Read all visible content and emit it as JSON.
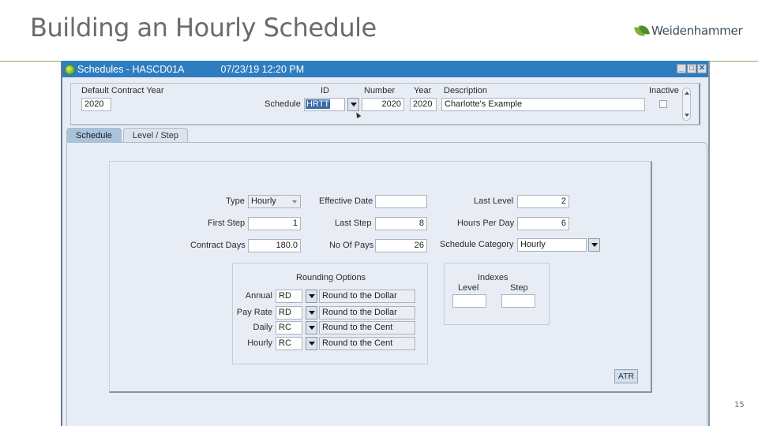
{
  "slide": {
    "title": "Building an Hourly Schedule",
    "logo_text": "Weidenhammer",
    "page_number": "15"
  },
  "window": {
    "title": "Schedules - HASCD01A",
    "timestamp": "07/23/19  12:20 PM",
    "controls": {
      "minimize": "_",
      "maximize": "□",
      "close": "✕"
    }
  },
  "header": {
    "default_contract_year_label": "Default Contract Year",
    "default_contract_year_value": "2020",
    "schedule_label": "Schedule",
    "id_label": "ID",
    "id_value": "HRTT",
    "number_label": "Number",
    "number_value": "2020",
    "year_label": "Year",
    "year_value": "2020",
    "description_label": "Description",
    "description_value": "Charlotte's Example",
    "inactive_label": "Inactive",
    "inactive_checked": false
  },
  "tabs": [
    {
      "label": "Schedule",
      "active": true
    },
    {
      "label": "Level / Step",
      "active": false
    }
  ],
  "form": {
    "type_label": "Type",
    "type_value": "Hourly",
    "effective_date_label": "Effective Date",
    "effective_date_value": "",
    "last_level_label": "Last Level",
    "last_level_value": "2",
    "first_step_label": "First Step",
    "first_step_value": "1",
    "last_step_label": "Last Step",
    "last_step_value": "8",
    "hours_per_day_label": "Hours Per Day",
    "hours_per_day_value": "6",
    "contract_days_label": "Contract Days",
    "contract_days_value": "180.0",
    "no_of_pays_label": "No Of Pays",
    "no_of_pays_value": "26",
    "schedule_category_label": "Schedule Category",
    "schedule_category_value": "Hourly"
  },
  "rounding": {
    "title": "Rounding Options",
    "rows": [
      {
        "label": "Annual",
        "code": "RD",
        "description": "Round to the Dollar"
      },
      {
        "label": "Pay Rate",
        "code": "RD",
        "description": "Round to the Dollar"
      },
      {
        "label": "Daily",
        "code": "RC",
        "description": "Round to the Cent"
      },
      {
        "label": "Hourly",
        "code": "RC",
        "description": "Round to the Cent"
      }
    ]
  },
  "indexes": {
    "title": "Indexes",
    "level_label": "Level",
    "level_value": "",
    "step_label": "Step",
    "step_value": ""
  },
  "atr_button": "ATR",
  "colors": {
    "titlebar": "#2e7dc0",
    "panel_bg": "#e8edf5",
    "active_tab": "#a9c3dc",
    "selection": "#3a6ea5",
    "rule_blue": "#2f7fbf",
    "rule_green": "#8aae6a"
  }
}
